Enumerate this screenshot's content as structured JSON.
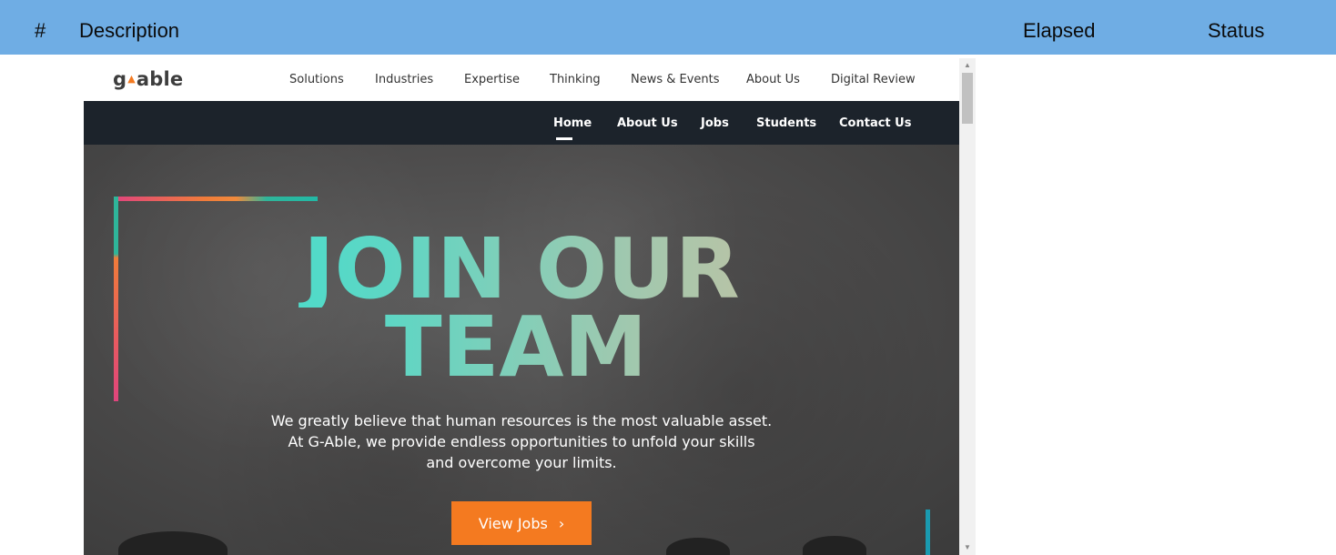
{
  "report_header": {
    "number": "#",
    "description": "Description",
    "elapsed": "Elapsed",
    "status": "Status",
    "background_color": "#6fade4"
  },
  "site": {
    "logo": {
      "g": "g",
      "dot": "▲",
      "rest": "able"
    },
    "top_nav": [
      "Solutions",
      "Industries",
      "Expertise",
      "Thinking",
      "News & Events",
      "About Us",
      "Digital Review"
    ],
    "sub_nav": [
      "Home",
      "About Us",
      "Jobs",
      "Students",
      "Contact Us"
    ],
    "active_sub_nav": "Home",
    "hero": {
      "title_line1": "JOIN OUR",
      "title_line2": "TEAM",
      "body_line1": "We greatly believe that human resources is the most valuable asset.",
      "body_line2": "At G-Able, we provide endless opportunities to unfold your skills",
      "body_line3": "and overcome your limits.",
      "button_label": "View Jobs",
      "button_chevron": "›",
      "button_color": "#f47a20"
    }
  },
  "scrollbar": {
    "up_arrow": "▲",
    "down_arrow": "▼"
  },
  "colors": {
    "nav_dark": "#1c232b",
    "accent_orange": "#f47a20"
  }
}
